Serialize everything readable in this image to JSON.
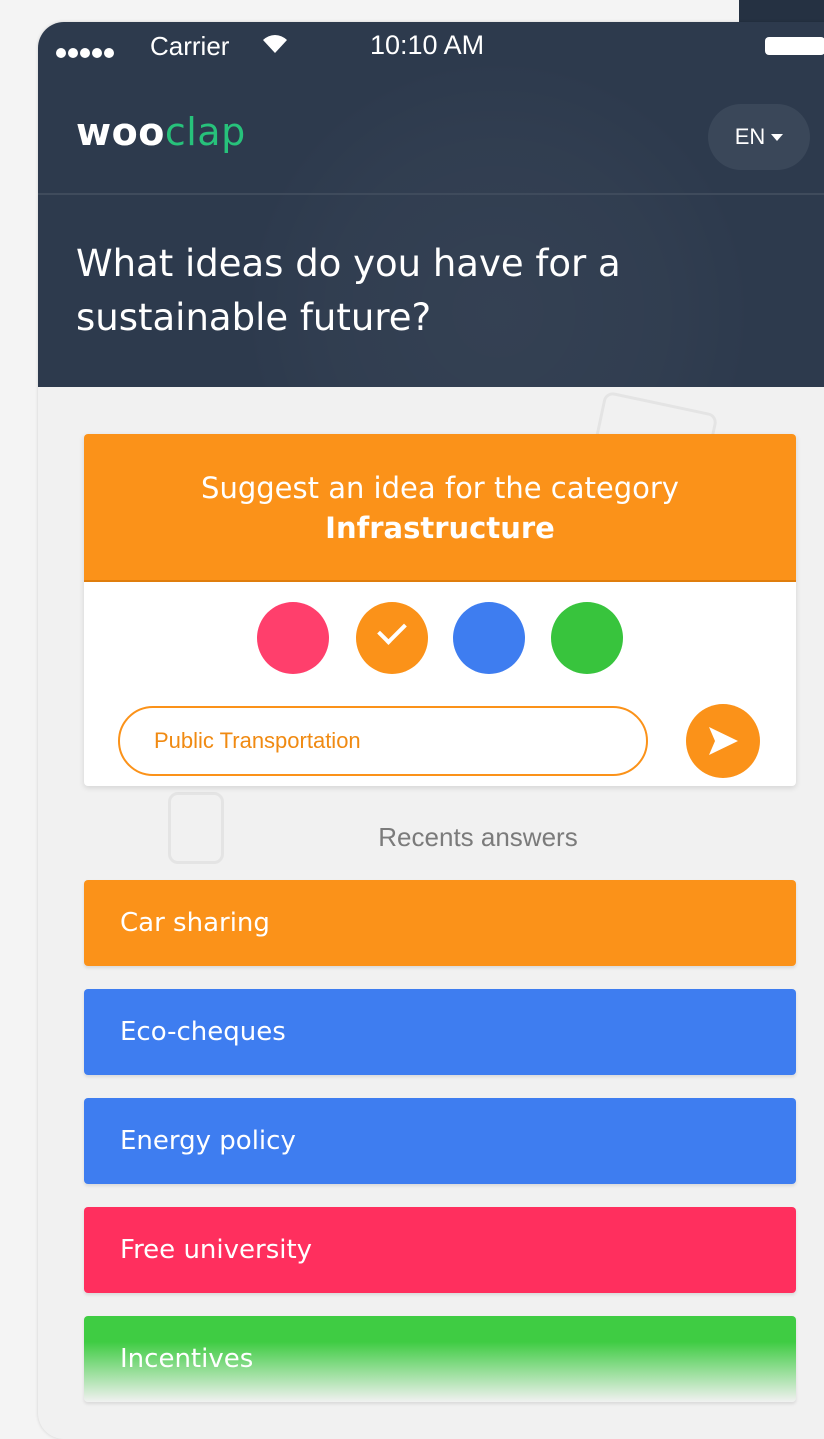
{
  "statusbar": {
    "carrier": "Carrier",
    "time": "10:10 AM",
    "icons": [
      "signal-dots-icon",
      "wifi-icon",
      "battery-icon"
    ]
  },
  "app": {
    "logo_part1": "woo",
    "logo_part2": "clap",
    "language": "EN",
    "question": "What ideas do you have for a sustainable future?"
  },
  "suggest": {
    "title": "Suggest an idea for the category",
    "category": "Infrastructure",
    "colors": [
      {
        "name": "pink",
        "hex": "#ff3f6c",
        "selected": false
      },
      {
        "name": "orange",
        "hex": "#fb9219",
        "selected": true
      },
      {
        "name": "blue",
        "hex": "#3e7df0",
        "selected": false
      },
      {
        "name": "green",
        "hex": "#38c43d",
        "selected": false
      }
    ],
    "input_value": "Public Transportation"
  },
  "recents": {
    "label": "Recents answers",
    "items": [
      {
        "label": "Car sharing",
        "color": "#fb9219"
      },
      {
        "label": "Eco-cheques",
        "color": "#3e7df0"
      },
      {
        "label": "Energy policy",
        "color": "#3e7df0"
      },
      {
        "label": "Free university",
        "color": "#ff2f5e"
      },
      {
        "label": "Incentives",
        "color": "#3fcc43"
      }
    ]
  },
  "theme": {
    "header_bg": "#2d3a4d",
    "accent_green": "#27c27b",
    "accent_orange": "#fb9219"
  }
}
